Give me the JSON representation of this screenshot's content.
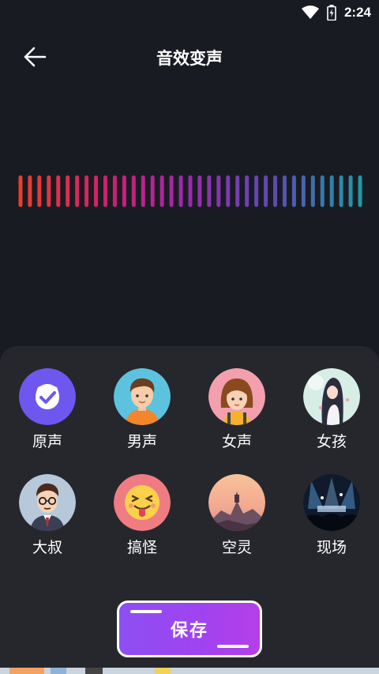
{
  "status_bar": {
    "time": "2:24",
    "icons": [
      "wifi-icon",
      "battery-charging-icon"
    ]
  },
  "header": {
    "title": "音效变声",
    "back_icon": "arrow-left-icon"
  },
  "waveform": {
    "bar_count": 37,
    "colors": [
      "#e8402c",
      "#d01f6f",
      "#9a2ab0",
      "#5a4cb0",
      "#1e9aa8"
    ]
  },
  "effects": [
    {
      "label": "原声",
      "icon": "checkmark-badge-icon",
      "selected": true
    },
    {
      "label": "男声",
      "icon": "man-avatar-icon"
    },
    {
      "label": "女声",
      "icon": "woman-avatar-icon"
    },
    {
      "label": "女孩",
      "icon": "girl-avatar-icon"
    },
    {
      "label": "大叔",
      "icon": "uncle-avatar-icon"
    },
    {
      "label": "搞怪",
      "icon": "funny-emoji-icon"
    },
    {
      "label": "空灵",
      "icon": "ethereal-landscape-icon"
    },
    {
      "label": "现场",
      "icon": "live-concert-icon"
    }
  ],
  "save_button": {
    "label": "保存"
  },
  "colors": {
    "background": "#191b22",
    "panel": "#26272c",
    "accent": "#6e57ef"
  }
}
